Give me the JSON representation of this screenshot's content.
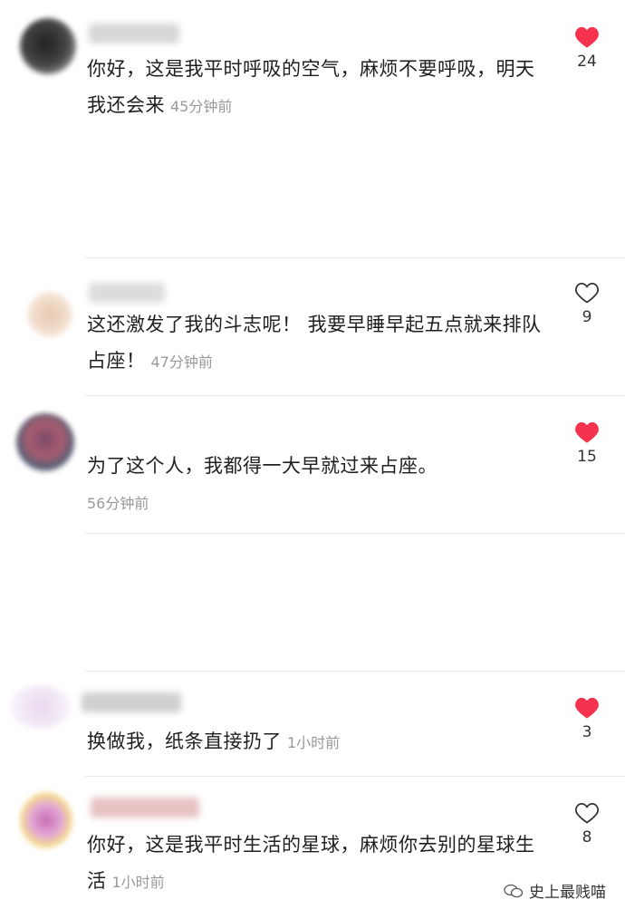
{
  "comments": [
    {
      "text": "你好，这是我平时呼吸的空气，麻烦不要呼吸，明天我还会来",
      "time": "45分钟前",
      "likes": "24",
      "liked": true
    },
    {
      "text": "这还激发了我的斗志呢！ 我要早睡早起五点就来排队占座！",
      "time": "47分钟前",
      "likes": "9",
      "liked": false
    },
    {
      "text": "为了这个人，我都得一大早就过来占座。",
      "time": "56分钟前",
      "likes": "15",
      "liked": true
    },
    {
      "text": "换做我，纸条直接扔了",
      "time": "1小时前",
      "likes": "3",
      "liked": true
    },
    {
      "text": "你好，这是我平时生活的星球，麻烦你去别的星球生活",
      "time": "1小时前",
      "likes": "8",
      "liked": false
    }
  ],
  "watermark": {
    "text": "史上最贱喵"
  },
  "colors": {
    "liked": "#f5334f",
    "unliked": "#333333",
    "time": "#999999"
  }
}
